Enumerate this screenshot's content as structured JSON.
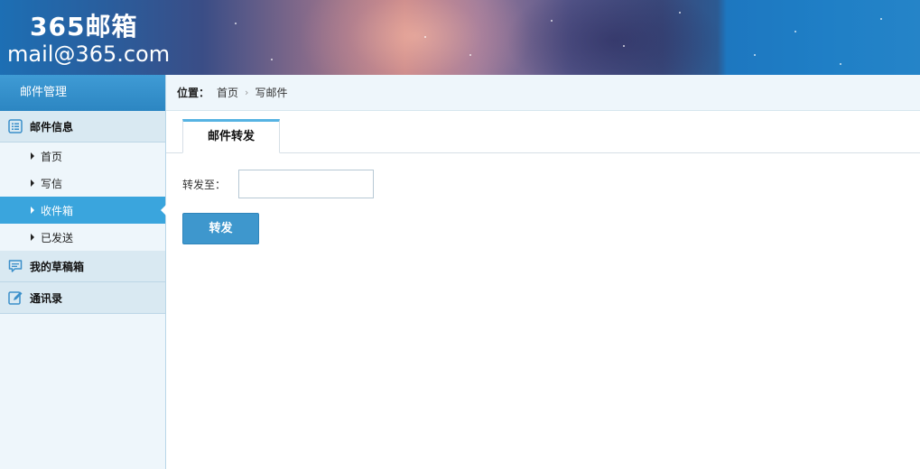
{
  "header": {
    "title": "365邮箱",
    "subtitle": "mail@365.com"
  },
  "sidebar": {
    "heading": "邮件管理",
    "groups": [
      {
        "label": "邮件信息",
        "icon": "list-icon"
      },
      {
        "label": "我的草稿箱",
        "icon": "chat-icon"
      },
      {
        "label": "通讯录",
        "icon": "edit-icon"
      }
    ],
    "items": [
      {
        "label": "首页"
      },
      {
        "label": "写信"
      },
      {
        "label": "收件箱",
        "active": true
      },
      {
        "label": "已发送"
      }
    ]
  },
  "breadcrumb": {
    "label": "位置：",
    "items": [
      "首页",
      "写邮件"
    ],
    "separator": "›"
  },
  "tabs": [
    {
      "label": "邮件转发",
      "active": true
    }
  ],
  "form": {
    "forward_label": "转发至：",
    "forward_value": "",
    "submit_label": "转发"
  },
  "colors": {
    "accent": "#3aa5dd",
    "button": "#3e97cd",
    "sidebar_bg": "#eef6fb"
  }
}
